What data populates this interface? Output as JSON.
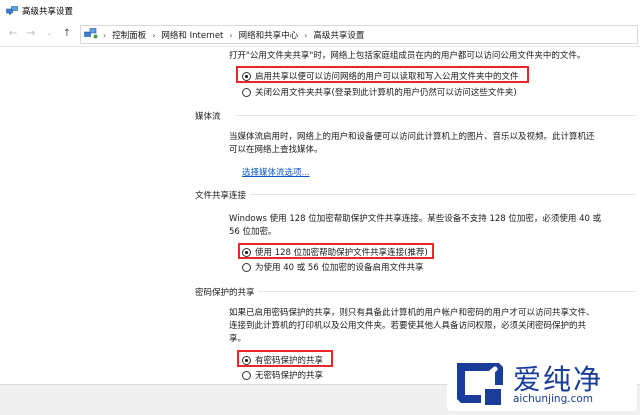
{
  "window": {
    "title": "高级共享设置"
  },
  "breadcrumb": [
    "控制面板",
    "网络和 Internet",
    "网络和共享中心",
    "高级共享设置"
  ],
  "public_folder": {
    "desc": "打开\"公用文件夹共享\"时，网络上包括家庭组成员在内的用户都可以访问公用文件夹中的文件。",
    "option_on": "启用共享以便可以访问网络的用户可以读取和写入公用文件夹中的文件",
    "option_off": "关闭公用文件夹共享(登录到此计算机的用户仍然可以访问这些文件夹)"
  },
  "media": {
    "heading": "媒体流",
    "desc_line1": "当媒体流启用时，网络上的用户和设备便可以访问此计算机上的图片、音乐以及视频。此计算机还",
    "desc_line2": "可以在网络上查找媒体。",
    "link": "选择媒体流选项..."
  },
  "file_sharing": {
    "heading": "文件共享连接",
    "desc_line1": "Windows 使用 128 位加密帮助保护文件共享连接。某些设备不支持 128 位加密，必须使用 40 或",
    "desc_line2": "56 位加密。",
    "option_128": "使用 128 位加密帮助保护文件共享连接(推荐)",
    "option_40": "为使用 40 或 56 位加密的设备启用文件共享"
  },
  "password": {
    "heading": "密码保护的共享",
    "desc_line1": "如果已启用密码保护的共享，则只有具备此计算机的用户帐户和密码的用户才可以访问共享文件、",
    "desc_line2": "连接到此计算机的打印机以及公用文件夹。若要使其他人具备访问权限，必须关闭密码保护的共",
    "desc_line3": "享。",
    "option_on": "有密码保护的共享",
    "option_off": "无密码保护的共享"
  },
  "watermark": {
    "cn": "爱纯净",
    "en": "aichunjing.com"
  },
  "colors": {
    "highlight": "#e8262b",
    "link": "#0c57c4",
    "brand": "#1a3d9a"
  }
}
